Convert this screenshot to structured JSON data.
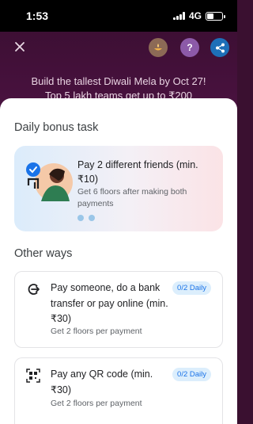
{
  "status_bar": {
    "time": "1:53",
    "network": "4G",
    "battery_percent": 45
  },
  "header": {
    "close_icon": "close-icon",
    "icons": [
      "diya-icon",
      "help-icon",
      "share-icon"
    ],
    "banner_line_1": "Build the tallest Diwali Mela by Oct 27!",
    "banner_line_2": "Top 5 lakh teams get up to ₹200"
  },
  "daily_bonus": {
    "section_title": "Daily bonus task",
    "card": {
      "title": "Pay 2 different friends (min. ₹10)",
      "subtitle": "Get 6 floors after making both payments",
      "progress_dots": 2
    }
  },
  "other_ways": {
    "section_title": "Other ways",
    "items": [
      {
        "icon": "payment-arrow-icon",
        "title": "Pay someone, do a bank transfer or pay online (min. ₹30)",
        "subtitle": "Get 2 floors per payment",
        "badge": "0/2 Daily"
      },
      {
        "icon": "qr-code-icon",
        "title": "Pay any QR code (min. ₹30)",
        "subtitle": "Get 2 floors per payment",
        "badge": "0/2 Daily"
      }
    ]
  },
  "colors": {
    "accent": "#1a73e8",
    "header_bg": "#3d0f34",
    "badge_bg": "#dceefc"
  }
}
